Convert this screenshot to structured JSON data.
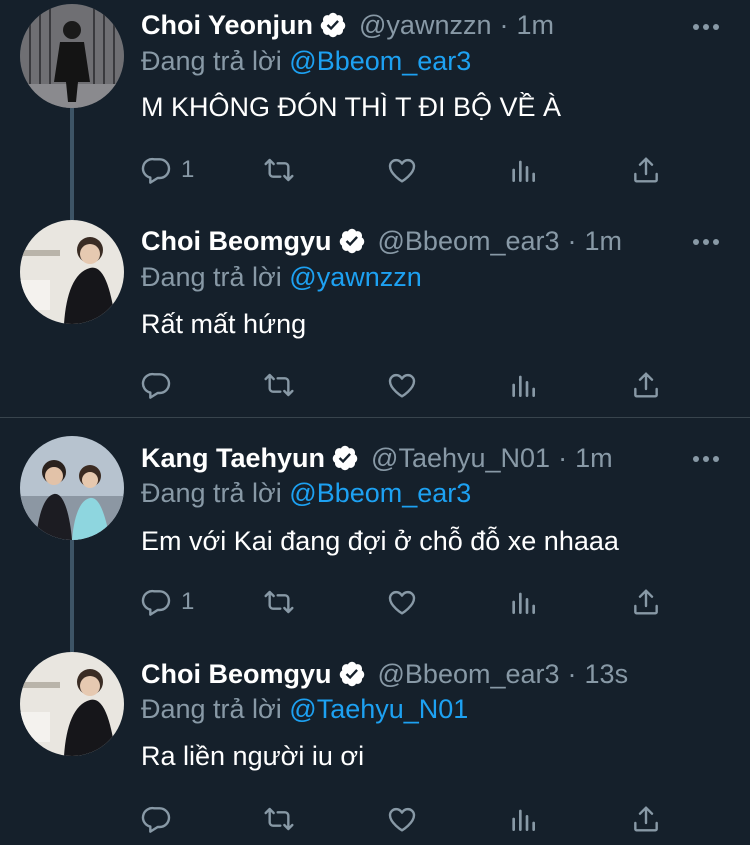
{
  "colors": {
    "background": "#15202b",
    "accent": "#1da1f2",
    "secondary_text": "#8899a6",
    "divider": "#38444d"
  },
  "reply_prefix": "Đang trả lời",
  "separator": "·",
  "tweets": [
    {
      "name": "Choi Yeonjun",
      "handle": "@yawnzzn",
      "time": "1m",
      "reply_to": "@Bbeom_ear3",
      "text": "M KHÔNG ĐÓN THÌ T ĐI BỘ VỀ À",
      "reply_count": "1",
      "verified": true
    },
    {
      "name": "Choi Beomgyu",
      "handle": "@Bbeom_ear3",
      "time": "1m",
      "reply_to": "@yawnzzn",
      "text": "Rất mất hứng",
      "reply_count": "",
      "verified": true
    },
    {
      "name": "Kang Taehyun",
      "handle": "@Taehyu_N01",
      "time": "1m",
      "reply_to": "@Bbeom_ear3",
      "text": "Em với Kai đang đợi ở chỗ đỗ xe nhaaa",
      "reply_count": "1",
      "verified": true
    },
    {
      "name": "Choi Beomgyu",
      "handle": "@Bbeom_ear3",
      "time": "13s",
      "reply_to": "@Taehyu_N01",
      "text": "Ra liền người iu ơi",
      "reply_count": "",
      "verified": true
    }
  ],
  "action_icons": [
    "reply-icon",
    "retweet-icon",
    "like-icon",
    "analytics-icon",
    "share-icon"
  ]
}
